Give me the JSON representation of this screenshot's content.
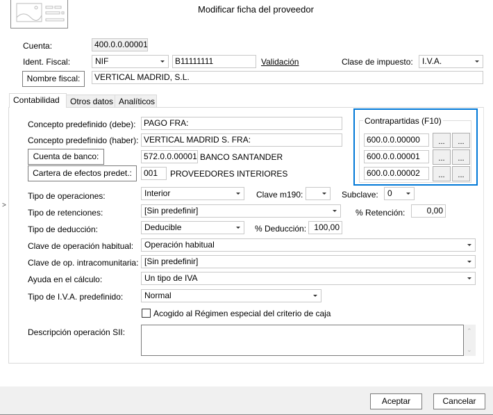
{
  "window": {
    "title": "Modificar ficha del proveedor"
  },
  "header": {
    "cuenta_label": "Cuenta:",
    "cuenta_value": "400.0.0.00001",
    "ident_label": "Ident. Fiscal:",
    "ident_type": "NIF",
    "ident_value": "B11111111",
    "validacion_link": "Validación",
    "clase_label": "Clase de impuesto:",
    "clase_value": "I.V.A.",
    "nombre_button": "Nombre fiscal:",
    "nombre_value": "VERTICAL MADRID, S.L."
  },
  "tabs": [
    {
      "label": "Contabilidad",
      "active": true
    },
    {
      "label": "Otros datos"
    },
    {
      "label": "Analíticos"
    }
  ],
  "contabilidad": {
    "concepto_debe_label": "Concepto predefinido (debe):",
    "concepto_debe_value": "PAGO FRA:",
    "concepto_haber_label": "Concepto predefinido (haber):",
    "concepto_haber_value": "VERTICAL MADRID S. FRA:",
    "cuenta_banco_button": "Cuenta de banco:",
    "cuenta_banco_value": "572.0.0.00001",
    "cuenta_banco_name": "BANCO SANTANDER",
    "cartera_button": "Cartera de efectos predet.:",
    "cartera_value": "001",
    "cartera_name": "PROVEEDORES INTERIORES",
    "contrapartidas": {
      "title": "Contrapartidas (F10)",
      "accounts": [
        "600.0.0.00000",
        "600.0.0.00001",
        "600.0.0.00002"
      ],
      "button_label": "..."
    },
    "tipo_operaciones_label": "Tipo de operaciones:",
    "tipo_operaciones_value": "Interior",
    "clave_m190_label": "Clave m190:",
    "clave_m190_value": "",
    "subclave_label": "Subclave:",
    "subclave_value": "0",
    "tipo_retenciones_label": "Tipo de retenciones:",
    "tipo_retenciones_value": "[Sin predefinir]",
    "retencion_label": "% Retención:",
    "retencion_value": "0,00",
    "tipo_deduccion_label": "Tipo de deducción:",
    "tipo_deduccion_value": "Deducible",
    "deduccion_label": "% Deducción:",
    "deduccion_value": "100,00",
    "clave_habitual_label": "Clave de operación habitual:",
    "clave_habitual_value": "Operación habitual",
    "clave_intra_label": "Clave de op. intracomunitaria:",
    "clave_intra_value": "[Sin predefinir]",
    "ayuda_label": "Ayuda en el cálculo:",
    "ayuda_value": "Un tipo de IVA",
    "tipo_iva_label": "Tipo de I.V.A. predefinido:",
    "tipo_iva_value": "Normal",
    "criterio_caja_label": "Acogido al Régimen especial del criterio de caja",
    "criterio_caja_checked": false,
    "descripcion_label": "Descripción operación SII:",
    "descripcion_value": ""
  },
  "footer": {
    "accept": "Aceptar",
    "cancel": "Cancelar"
  },
  "colors": {
    "focus_border": "#0078d7",
    "footer_bg": "#f0f0f0"
  }
}
